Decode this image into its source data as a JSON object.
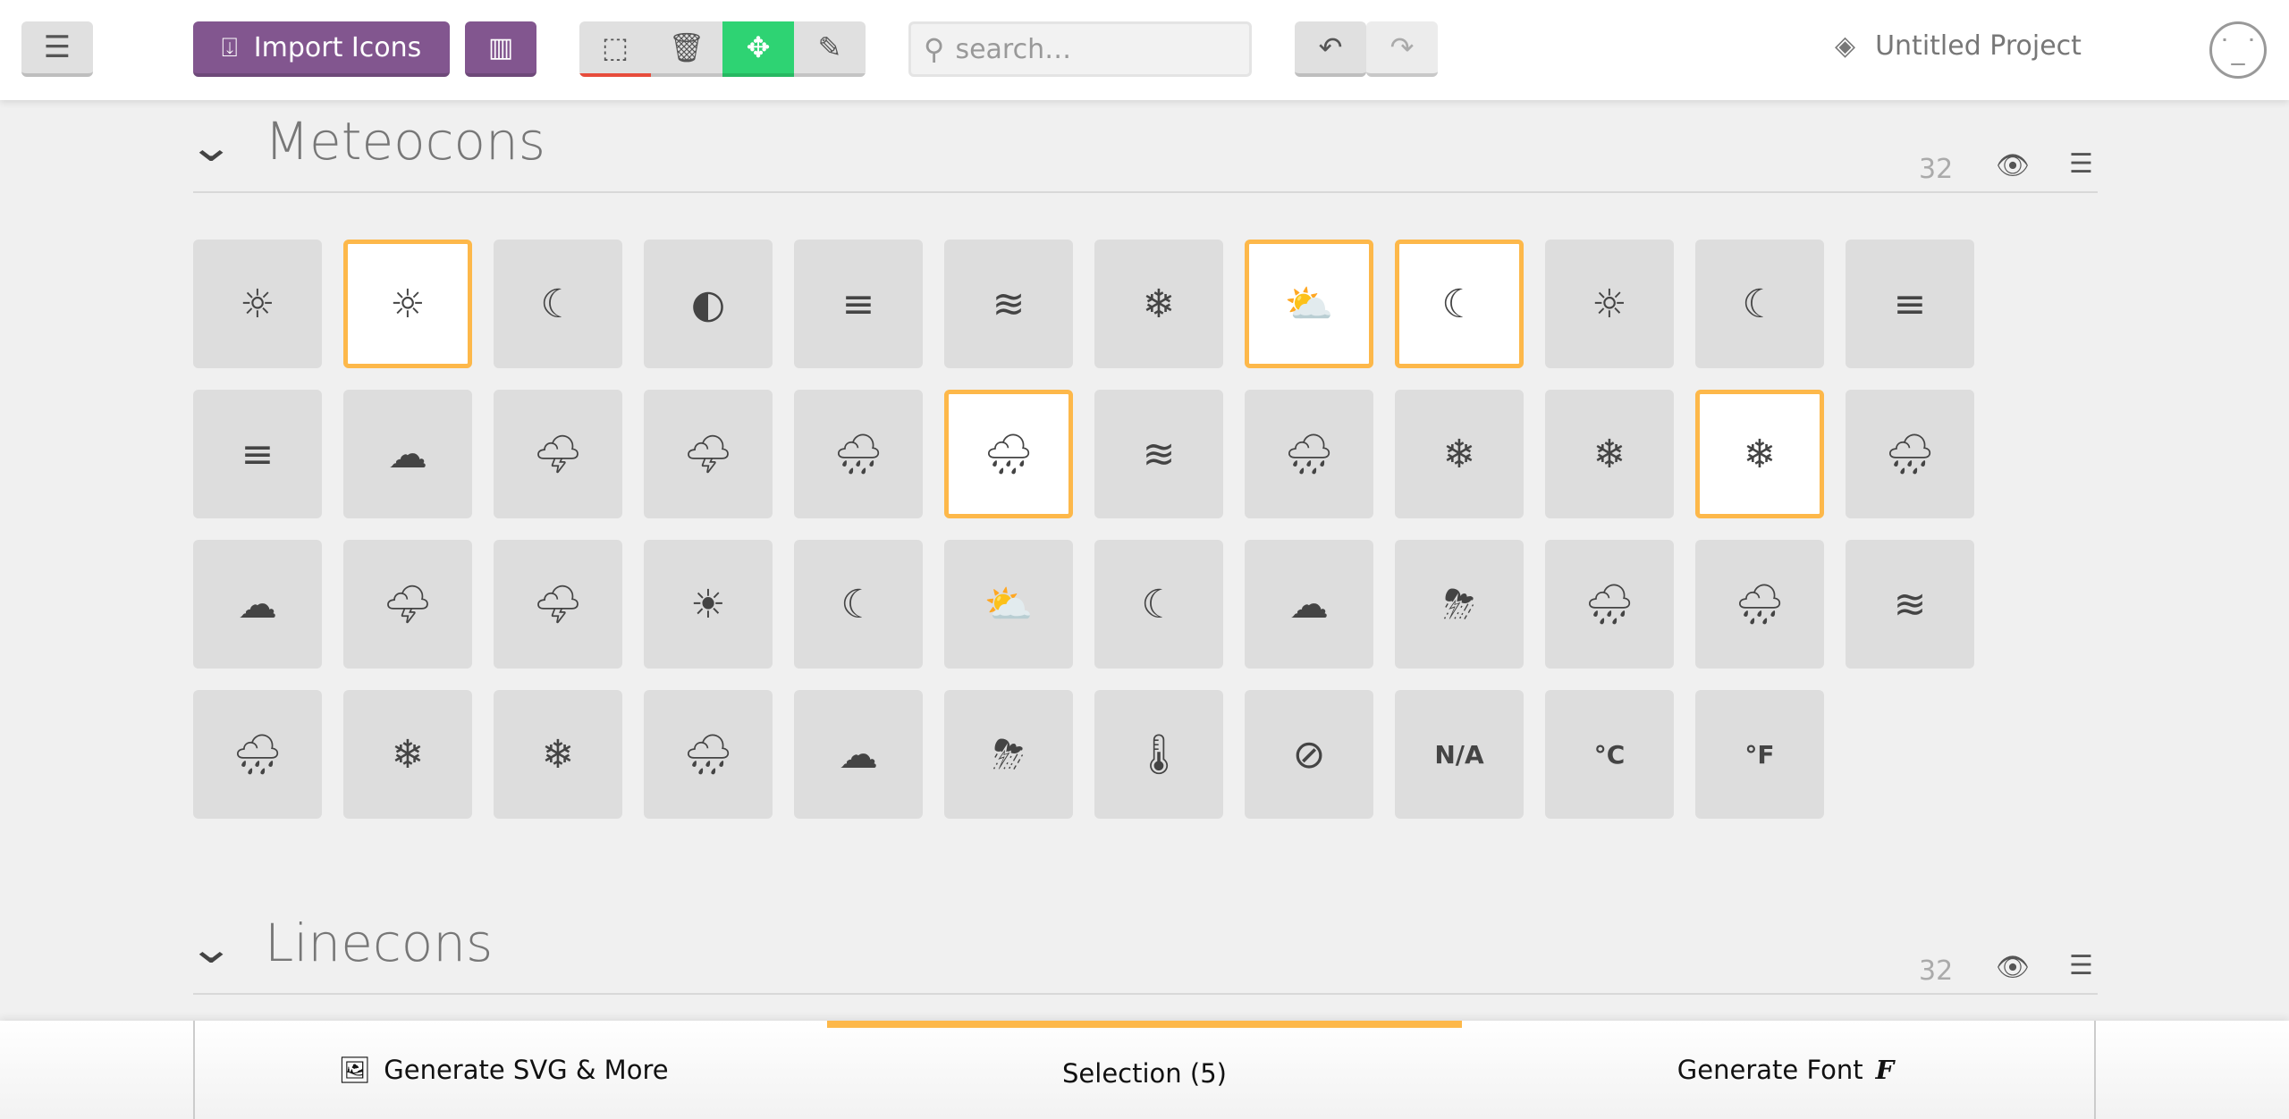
{
  "toolbar": {
    "menu_icon": "hamburger-icon",
    "import_label": "Import Icons",
    "search_placeholder": "search…",
    "project_title": "Untitled Project",
    "tools": [
      "select",
      "delete",
      "move",
      "edit"
    ],
    "active_tool": "move",
    "colors": {
      "purple": "#82568f",
      "move_active": "#2ed373",
      "select_underline": "#e74c3c",
      "selection": "#fdb84a"
    }
  },
  "sections": [
    {
      "title": "Meteocons",
      "count": "32",
      "icons": [
        {
          "name": "sunrise",
          "selected": false
        },
        {
          "name": "sun",
          "selected": true
        },
        {
          "name": "moon",
          "selected": false
        },
        {
          "name": "eclipse",
          "selected": false
        },
        {
          "name": "planet-fog",
          "selected": false
        },
        {
          "name": "wind",
          "selected": false
        },
        {
          "name": "snowflake",
          "selected": false
        },
        {
          "name": "cloud-sun",
          "selected": true
        },
        {
          "name": "cloud-moon",
          "selected": true
        },
        {
          "name": "fog-sun",
          "selected": false
        },
        {
          "name": "fog-moon",
          "selected": false
        },
        {
          "name": "fog-cloud",
          "selected": false
        },
        {
          "name": "fog",
          "selected": false
        },
        {
          "name": "cloud",
          "selected": false
        },
        {
          "name": "cloud-lightning",
          "selected": false
        },
        {
          "name": "cloud-lightning-alt",
          "selected": false
        },
        {
          "name": "cloud-drizzle",
          "selected": false
        },
        {
          "name": "cloud-rain",
          "selected": true
        },
        {
          "name": "cloud-wind",
          "selected": false
        },
        {
          "name": "cloud-wind-rain",
          "selected": false
        },
        {
          "name": "cloud-snow",
          "selected": false
        },
        {
          "name": "cloud-snow-alt",
          "selected": false
        },
        {
          "name": "cloud-snow-heavy",
          "selected": true
        },
        {
          "name": "cloud-hail",
          "selected": false
        },
        {
          "name": "clouds",
          "selected": false
        },
        {
          "name": "clouds-lightning",
          "selected": false
        },
        {
          "name": "clouds-lightning-alt",
          "selected": false
        },
        {
          "name": "sun-filled",
          "selected": false
        },
        {
          "name": "moon-filled",
          "selected": false
        },
        {
          "name": "cloud-sun-filled",
          "selected": false
        },
        {
          "name": "cloud-moon-filled",
          "selected": false
        },
        {
          "name": "cloud-filled",
          "selected": false
        },
        {
          "name": "cloud-lightning-filled",
          "selected": false
        },
        {
          "name": "cloud-drizzle-filled",
          "selected": false
        },
        {
          "name": "cloud-rain-filled",
          "selected": false
        },
        {
          "name": "cloud-wind-filled",
          "selected": false
        },
        {
          "name": "cloud-wind-rain-filled",
          "selected": false
        },
        {
          "name": "cloud-snow-filled",
          "selected": false
        },
        {
          "name": "cloud-snow-heavy-filled",
          "selected": false
        },
        {
          "name": "cloud-hail-filled",
          "selected": false
        },
        {
          "name": "clouds-filled",
          "selected": false
        },
        {
          "name": "clouds-lightning-filled",
          "selected": false
        },
        {
          "name": "thermometer",
          "selected": false
        },
        {
          "name": "compass",
          "selected": false
        },
        {
          "name": "not-available",
          "text": "N/A",
          "selected": false
        },
        {
          "name": "celsius",
          "text": "°C",
          "selected": false
        },
        {
          "name": "fahrenheit",
          "text": "°F",
          "selected": false
        }
      ]
    },
    {
      "title": "Linecons",
      "count": "32"
    }
  ],
  "bottom": {
    "generate_svg": "Generate SVG & More",
    "selection": "Selection (5)",
    "generate_font": "Generate Font"
  }
}
